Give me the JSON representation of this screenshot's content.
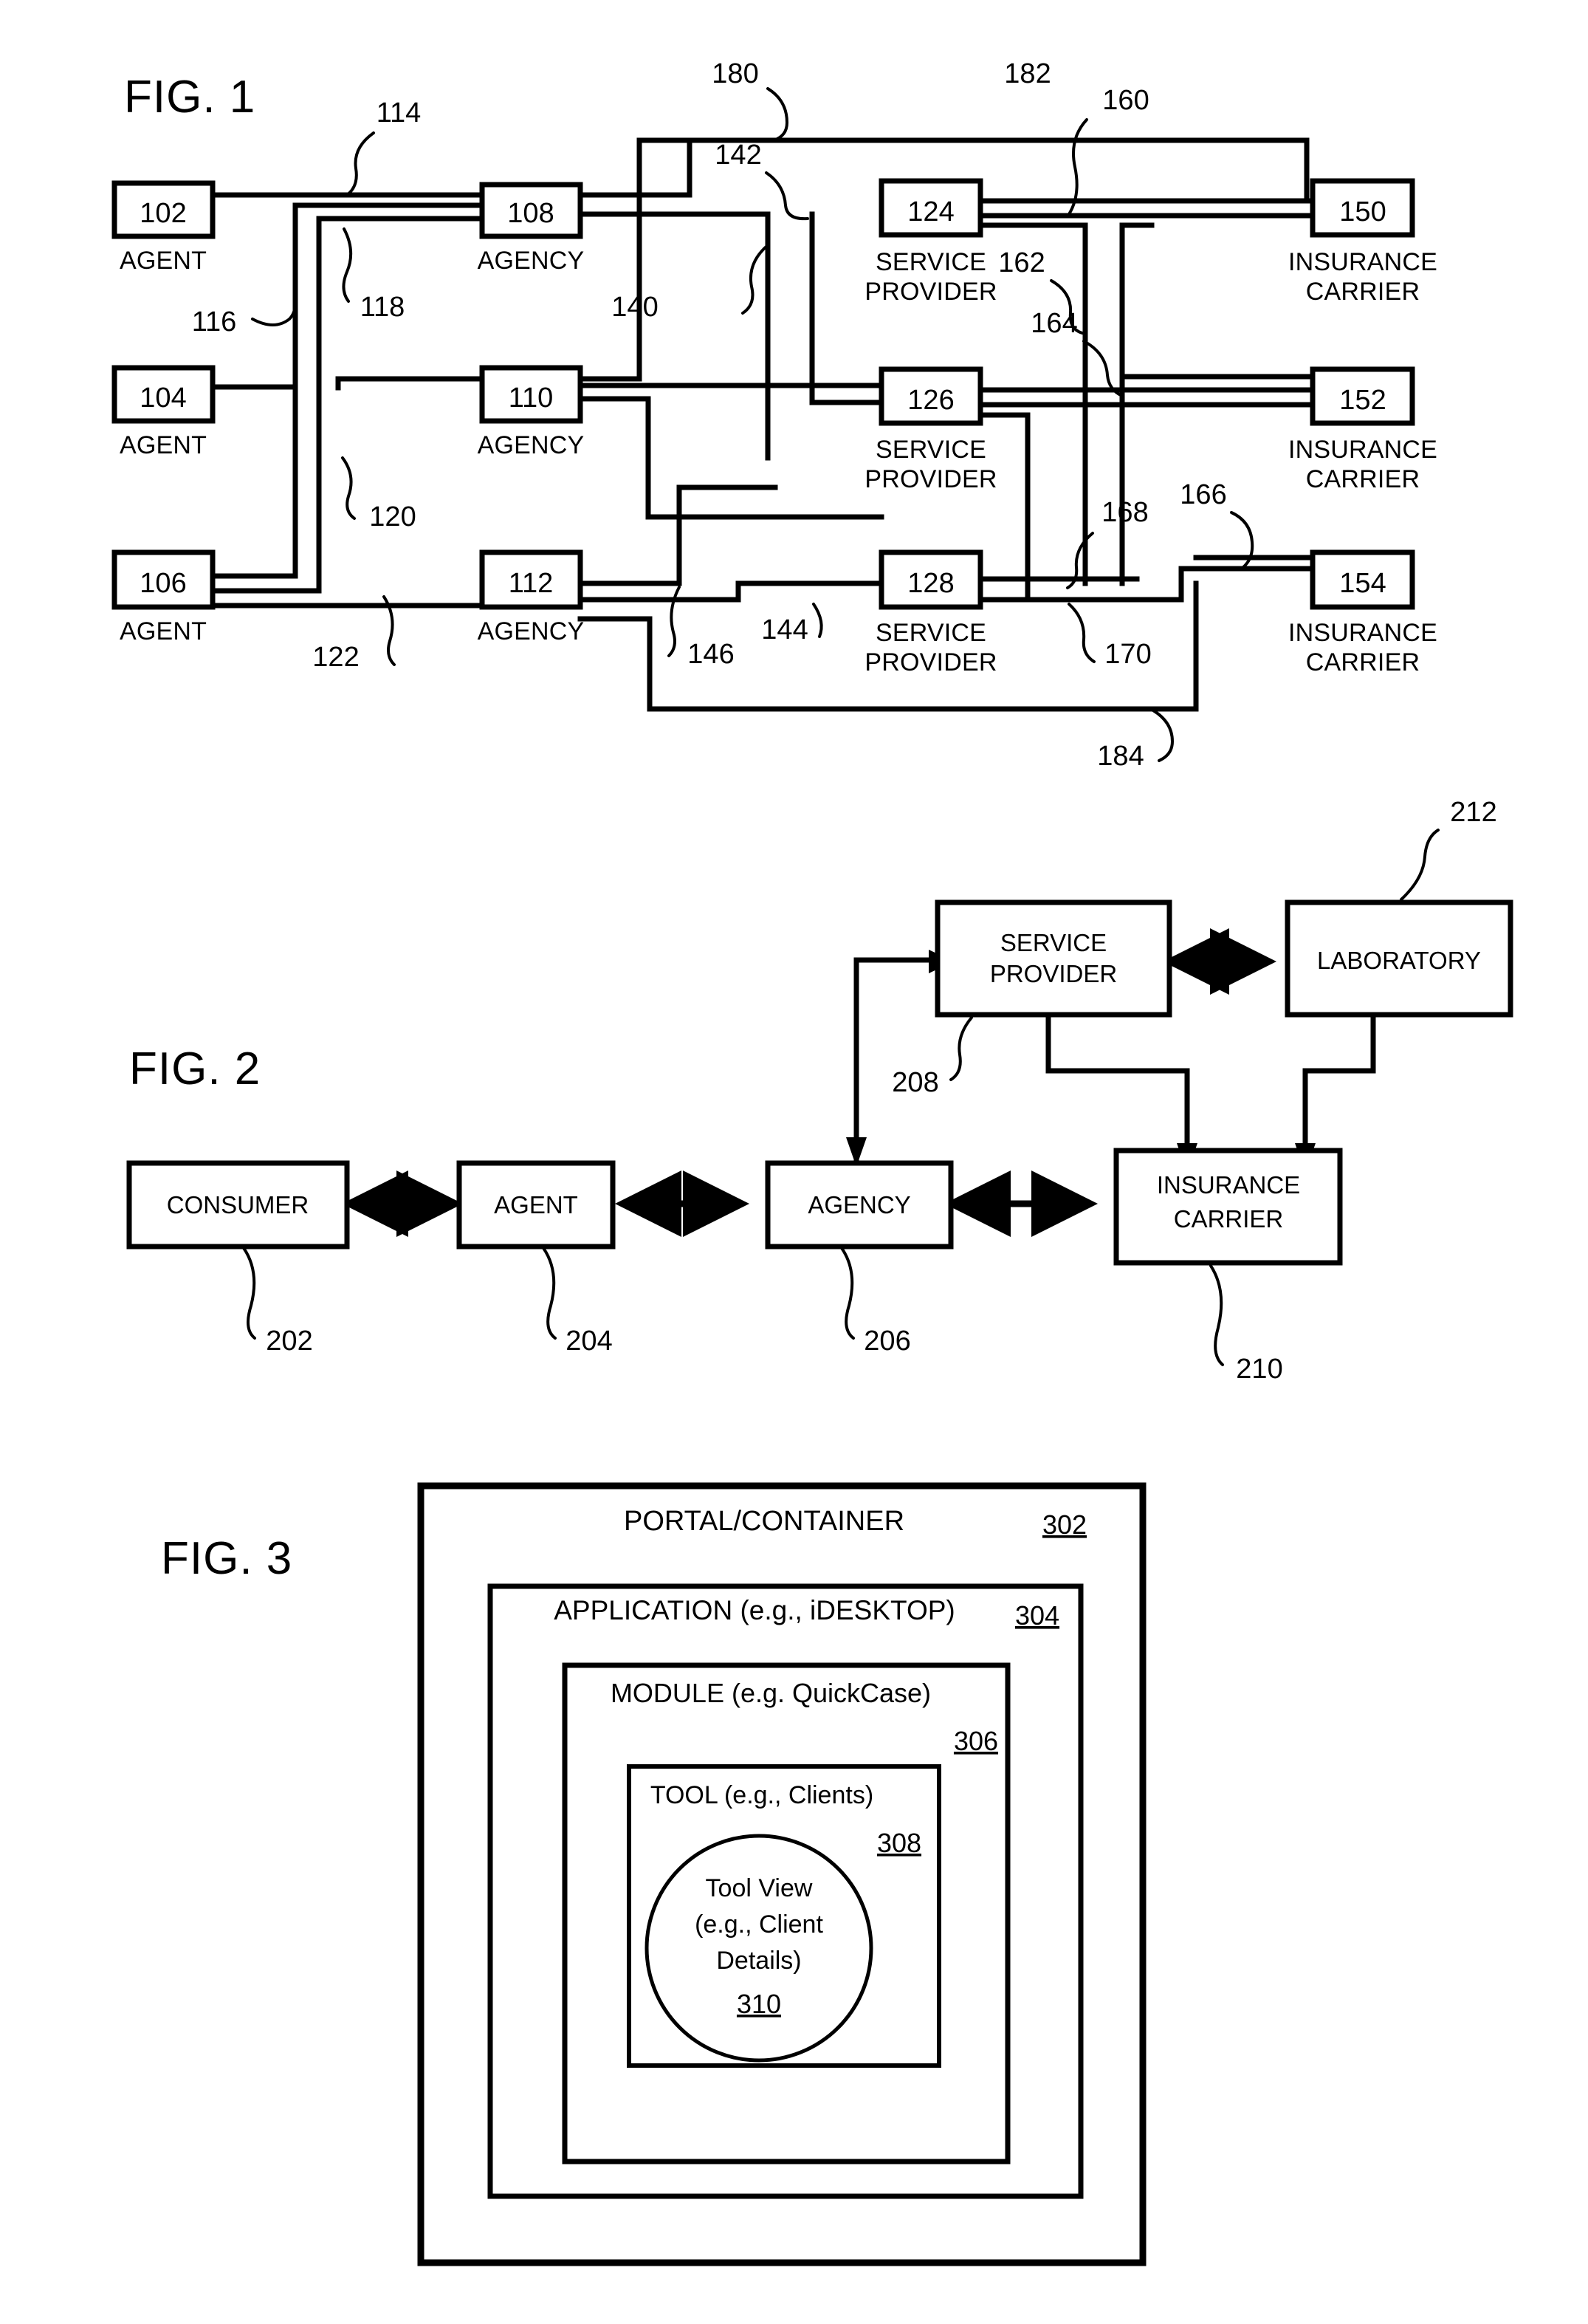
{
  "figures": [
    {
      "id": "fig1",
      "title": "FIG. 1",
      "nodes": [
        {
          "num": "102",
          "label": "AGENT"
        },
        {
          "num": "104",
          "label": "AGENT"
        },
        {
          "num": "106",
          "label": "AGENT"
        },
        {
          "num": "108",
          "label": "AGENCY"
        },
        {
          "num": "110",
          "label": "AGENCY"
        },
        {
          "num": "112",
          "label": "AGENCY"
        },
        {
          "num": "124",
          "label": "SERVICE PROVIDER"
        },
        {
          "num": "126",
          "label": "SERVICE PROVIDER"
        },
        {
          "num": "128",
          "label": "SERVICE PROVIDER"
        },
        {
          "num": "150",
          "label": "INSURANCE CARRIER"
        },
        {
          "num": "152",
          "label": "INSURANCE CARRIER"
        },
        {
          "num": "154",
          "label": "INSURANCE CARRIER"
        }
      ],
      "connection_refs": [
        "114",
        "116",
        "118",
        "120",
        "122",
        "140",
        "142",
        "144",
        "146",
        "160",
        "162",
        "164",
        "166",
        "168",
        "170",
        "180",
        "182",
        "184"
      ]
    },
    {
      "id": "fig2",
      "title": "FIG. 2",
      "nodes": [
        {
          "num": "202",
          "label": "CONSUMER"
        },
        {
          "num": "204",
          "label": "AGENT"
        },
        {
          "num": "206",
          "label": "AGENCY"
        },
        {
          "num": "208",
          "label": "SERVICE PROVIDER"
        },
        {
          "num": "210",
          "label": "INSURANCE CARRIER"
        },
        {
          "num": "212",
          "label": "LABORATORY"
        }
      ]
    },
    {
      "id": "fig3",
      "title": "FIG. 3",
      "layers": [
        {
          "num": "302",
          "label": "PORTAL/CONTAINER"
        },
        {
          "num": "304",
          "label": "APPLICATION (e.g., iDESKTOP)"
        },
        {
          "num": "306",
          "label": "MODULE  (e.g. QuickCase)"
        },
        {
          "num": "308",
          "label": "TOOL (e.g., Clients)"
        },
        {
          "num": "310",
          "label": "Tool View (e.g., Client Details)"
        }
      ],
      "tool_view_lines": [
        "Tool View",
        "(e.g., Client",
        "Details)"
      ]
    }
  ],
  "fig1_labels": {
    "agent_text": "AGENT",
    "agency_text": "AGENCY",
    "service_line1": "SERVICE",
    "service_line2": "PROVIDER",
    "carrier_line1": "INSURANCE",
    "carrier_line2": "CARRIER"
  },
  "colors": {
    "ink": "#000000",
    "paper": "#ffffff"
  }
}
